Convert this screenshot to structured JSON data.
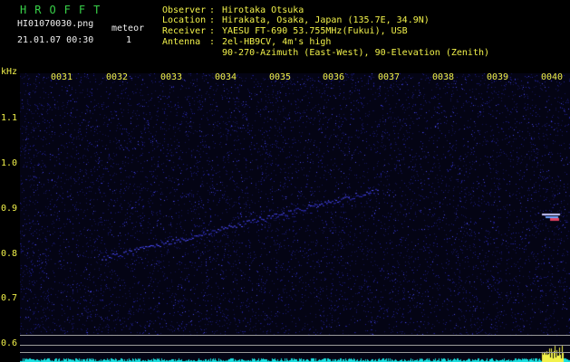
{
  "header": {
    "logo": "HROFFT",
    "filename": "HI01070030.png",
    "datetime": "21.01.07 00:30",
    "meteor_label": "meteor",
    "meteor_count": "1",
    "info_keys": [
      "Observer",
      "Location",
      "Receiver",
      "Antenna",
      ""
    ],
    "info_values": [
      "Hirotaka Otsuka",
      "Hirakata, Osaka, Japan (135.7E, 34.9N)",
      "YAESU FT-690 53.755MHz(Fukui), USB",
      "2el-HB9CV, 4m's high",
      "90-270-Azimuth (East-West), 90-Elevation (Zenith)"
    ]
  },
  "axis": {
    "y_unit": "kHz",
    "y_ticks": [
      "1.1",
      "1.0",
      "0.9",
      "0.8",
      "0.7",
      "0.6"
    ],
    "x_ticks": [
      "0031",
      "0032",
      "0033",
      "0034",
      "0035",
      "0036",
      "0037",
      "0038",
      "0039",
      "0040"
    ]
  },
  "colors": {
    "background": "#000000",
    "header_green": "#38d048",
    "text_white": "#f0f0f0",
    "axis_yellow": "#f2f24a",
    "noise_blue": "#2a2ab8",
    "baseline_cyan": "#1ae0e0"
  }
}
